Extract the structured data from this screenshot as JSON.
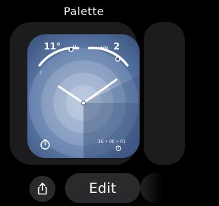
{
  "header": {
    "title": "Palette"
  },
  "face": {
    "temperature": "11°",
    "temp_low_marker": "7",
    "temp_high_marker": "11",
    "aqi_label": "AQI",
    "aqi_value": "2",
    "timer_time": "16 • 00 • 01",
    "hands": {
      "hour": "10",
      "minute": "10"
    }
  },
  "buttons": {
    "edit_label": "Edit"
  },
  "icons": {
    "share": "share-icon",
    "timer": "stopwatch-icon",
    "alarm": "small-icon"
  },
  "colors": {
    "face_fill": "#6d8ab3",
    "face_dark": "#3e5a85",
    "face_light": "#b6c7de",
    "ring": "#ffffff"
  }
}
